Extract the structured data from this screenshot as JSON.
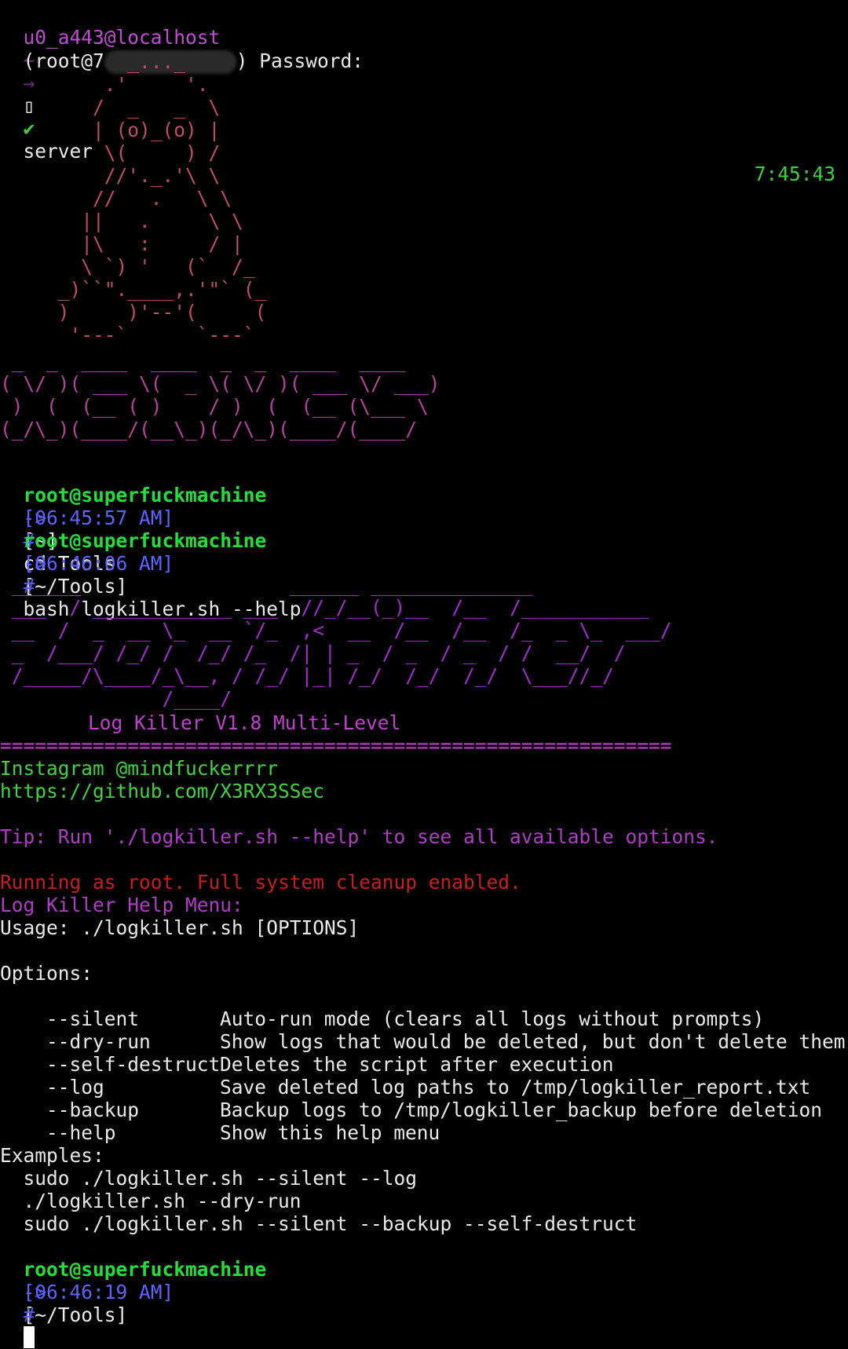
{
  "statusbar": {
    "user": "u0_a443@localhost",
    "tilde": "~",
    "arrow": "→",
    "box": "▯",
    "check": "✔",
    "label": "server",
    "clock": "7:45:43"
  },
  "password_line": {
    "prefix": "(root@7",
    "suffix": ") Password:"
  },
  "penguin_art": "           _..._\n         .'     '.\n        /  _   _  \\\n        | (o)_(o) |\n         \\(     ) /\n         //'._.'\\ \\\n        //   .   \\ \\\n       ||   .     \\ \\\n       |\\   :     / |\n       \\ `) '   (`  /_\n     _)``\".____,.'\"` (_\n     )     )'--'(     (\n      '---`      `---`",
  "xer_art": " _  _  ____  ____  _  _  ____  ____ \n( \\/ )( ___ \\(  _ \\( \\/ )( ___ \\/ ___)\n )  (  (__ ( )    / )  (  (__ (\\___ \\\n(_/\\_)(____/(__\\_)(_/\\_)(____/(____/",
  "prompts": [
    {
      "user": "root@superfuckmachine",
      "time": "[06:45:57 AM]",
      "path": "[~]",
      "arrow": "->",
      "hash": "#",
      "command": "cd Tools"
    },
    {
      "user": "root@superfuckmachine",
      "time": "[06:46:06 AM]",
      "path": "[~/Tools]",
      "arrow": "->",
      "hash": "#",
      "command": "bash logkiller.sh --help"
    },
    {
      "user": "root@superfuckmachine",
      "time": "[06:46:19 AM]",
      "path": "[~/Tools]",
      "arrow": "->",
      "hash": "#",
      "command": ""
    }
  ],
  "logkiller_art": " ______                  ______ ______________\n ___  / ____________ ___  //_/__(_)__  /__  /___________\n __  /  _  __ \\_  __ `/_  ,<  __  /__  /__  /_  _ \\_  ___/\n _  /___/ /_/ /  /_/ /_  /| | _  / _  / _  / /  __/  /\n /_____/\\____/_\\__, / /_/ |_| /_/  /_/  /_/  \\___//_/\n              /____/",
  "banner": {
    "title": "Log Killer V1.8 Multi-Level",
    "rule": "==========================================================",
    "instagram": "Instagram @mindfuckerrrr",
    "github": "https://github.com/X3RX3SSec",
    "tip": "Tip: Run './logkiller.sh --help' to see all available options.",
    "root_warning": "Running as root. Full system cleanup enabled.",
    "help_title": "Log Killer Help Menu:",
    "usage": "Usage: ./logkiller.sh [OPTIONS]"
  },
  "options_header": "Options:",
  "options": [
    {
      "flag": "  --silent",
      "desc": "Auto-run mode (clears all logs without prompts)"
    },
    {
      "flag": "  --dry-run",
      "desc": "Show logs that would be deleted, but don't delete them"
    },
    {
      "flag": "  --self-destruct",
      "desc": "Deletes the script after execution"
    },
    {
      "flag": "  --log",
      "desc": "Save deleted log paths to /tmp/logkiller_report.txt"
    },
    {
      "flag": "  --backup",
      "desc": "Backup logs to /tmp/logkiller_backup before deletion"
    },
    {
      "flag": "  --help",
      "desc": "Show this help menu"
    }
  ],
  "examples_header": "Examples:",
  "examples": [
    "  sudo ./logkiller.sh --silent --log",
    "  ./logkiller.sh --dry-run",
    "  sudo ./logkiller.sh --silent --backup --self-destruct"
  ],
  "colors": {
    "background": "#000000",
    "prompt_user": "#22e03a",
    "prompt_time": "#5c63ff",
    "banner_magenta": "#c23fd0",
    "warning_red": "#c81e1e"
  }
}
